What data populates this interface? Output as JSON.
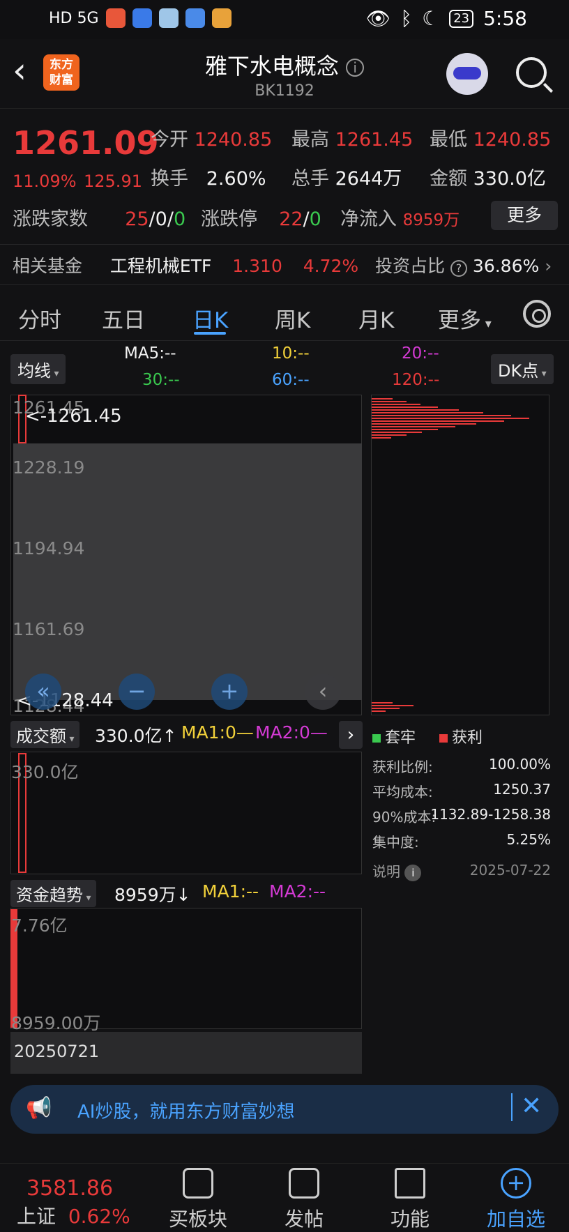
{
  "status_bar": {
    "left": "HD 5G",
    "time": "5:58",
    "battery": "23"
  },
  "header": {
    "logo_text": "东方\n财富",
    "title": "雅下水电概念",
    "code": "BK1192"
  },
  "quote": {
    "price": "1261.09",
    "change_pct": "11.09%",
    "change_abs": "125.91",
    "open_label": "今开",
    "open": "1240.85",
    "high_label": "最高",
    "high": "1261.45",
    "low_label": "最低",
    "low": "1240.85",
    "turnover_label": "换手",
    "turnover": "2.60%",
    "volume_label": "总手",
    "volume": "2644万",
    "amount_label": "金额",
    "amount": "330.0亿",
    "updown_label": "涨跌家数",
    "up": "25",
    "flat": "0",
    "down": "0",
    "limit_label": "涨跌停",
    "limit_up": "22",
    "limit_down": "0",
    "netflow_label": "净流入",
    "netflow": "8959万",
    "more_btn": "更多",
    "fund_label": "相关基金",
    "fund_name": "工程机械ETF",
    "fund_price": "1.310",
    "fund_pct": "4.72%",
    "ratio_label": "投资占比",
    "ratio": "36.86%"
  },
  "tabs": [
    "分时",
    "五日",
    "日K",
    "周K",
    "月K",
    "更多"
  ],
  "ma": {
    "chip": "均线",
    "ma5": "MA5:--",
    "ma10": "10:--",
    "ma20": "20:--",
    "ma30": "30:--",
    "ma60": "60:--",
    "ma120": "120:--",
    "dk_btn": "DK点"
  },
  "main_chart": {
    "axis": [
      "1261.45",
      "1228.19",
      "1194.94",
      "1161.69",
      "1128.44"
    ],
    "high_marker": "<-1261.45",
    "low_marker": "<-1128.44"
  },
  "volume": {
    "chip": "成交额",
    "value": "330.0亿↑",
    "ma1": "MA1:0—",
    "ma2": "MA2:0—",
    "axis_top": "330.0亿"
  },
  "flow": {
    "chip": "资金趋势",
    "value": "8959万↓",
    "ma1": "MA1:--",
    "ma2": "MA2:--",
    "axis_top": "7.76亿",
    "axis_bottom": "8959.00万",
    "date": "20250721"
  },
  "distribution": {
    "legend_trap": "套牢",
    "legend_profit": "获利",
    "rows": [
      {
        "label": "获利比例:",
        "value": "100.00%"
      },
      {
        "label": "平均成本:",
        "value": "1250.37"
      },
      {
        "label": "90%成本:",
        "value": "1132.89-1258.38"
      },
      {
        "label": "集中度:",
        "value": "5.25%"
      }
    ],
    "explain": "说明",
    "date": "2025-07-22"
  },
  "ai_bar": {
    "text": "AI炒股，就用东方财富妙想"
  },
  "bottom_nav": {
    "index_value": "3581.86",
    "index_name": "上证",
    "index_pct": "0.62%",
    "items": [
      "买板块",
      "发帖",
      "功能",
      "加自选"
    ]
  },
  "colors": {
    "up": "#e83a3a",
    "down": "#3ac94f",
    "accent": "#4aa3ff"
  }
}
